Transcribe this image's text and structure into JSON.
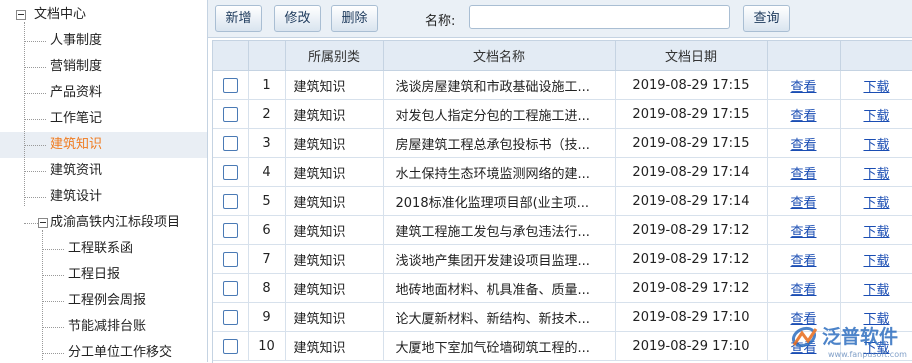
{
  "tree": {
    "items": [
      {
        "label": "文档中心",
        "level": 0,
        "expander": "−"
      },
      {
        "label": "人事制度",
        "level": 1
      },
      {
        "label": "营销制度",
        "level": 1
      },
      {
        "label": "产品资料",
        "level": 1
      },
      {
        "label": "工作笔记",
        "level": 1
      },
      {
        "label": "建筑知识",
        "level": 1,
        "selected": true
      },
      {
        "label": "建筑资讯",
        "level": 1
      },
      {
        "label": "建筑设计",
        "level": 1
      },
      {
        "label": "成渝高铁内江标段项目",
        "level": 1,
        "expander": "−"
      },
      {
        "label": "工程联系函",
        "level": 2
      },
      {
        "label": "工程日报",
        "level": 2
      },
      {
        "label": "工程例会周报",
        "level": 2
      },
      {
        "label": "节能减排台账",
        "level": 2
      },
      {
        "label": "分工单位工作移交",
        "level": 2
      }
    ]
  },
  "toolbar": {
    "add_label": "新增",
    "edit_label": "修改",
    "delete_label": "删除",
    "name_label": "名称:",
    "name_value": "",
    "query_label": "查询"
  },
  "grid": {
    "headers": [
      "",
      "",
      "所属别类",
      "文档名称",
      "文档日期",
      "",
      ""
    ],
    "rows": [
      {
        "index": "1",
        "category": "建筑知识",
        "name": "浅谈房屋建筑和市政基础设施工...",
        "date": "2019-08-29 17:15",
        "view": "查看",
        "download": "下载"
      },
      {
        "index": "2",
        "category": "建筑知识",
        "name": "对发包人指定分包的工程施工进...",
        "date": "2019-08-29 17:15",
        "view": "查看",
        "download": "下载"
      },
      {
        "index": "3",
        "category": "建筑知识",
        "name": "房屋建筑工程总承包投标书（技...",
        "date": "2019-08-29 17:15",
        "view": "查看",
        "download": "下载"
      },
      {
        "index": "4",
        "category": "建筑知识",
        "name": "水土保持生态环境监测网络的建...",
        "date": "2019-08-29 17:14",
        "view": "查看",
        "download": "下载"
      },
      {
        "index": "5",
        "category": "建筑知识",
        "name": "2018标准化监理项目部(业主项...",
        "date": "2019-08-29 17:14",
        "view": "查看",
        "download": "下载"
      },
      {
        "index": "6",
        "category": "建筑知识",
        "name": "建筑工程施工发包与承包违法行...",
        "date": "2019-08-29 17:12",
        "view": "查看",
        "download": "下载"
      },
      {
        "index": "7",
        "category": "建筑知识",
        "name": "浅谈地产集团开发建设项目监理...",
        "date": "2019-08-29 17:12",
        "view": "查看",
        "download": "下载"
      },
      {
        "index": "8",
        "category": "建筑知识",
        "name": "地砖地面材料、机具准备、质量...",
        "date": "2019-08-29 17:12",
        "view": "查看",
        "download": "下载"
      },
      {
        "index": "9",
        "category": "建筑知识",
        "name": "论大厦新材料、新结构、新技术...",
        "date": "2019-08-29 17:10",
        "view": "查看",
        "download": "下载"
      },
      {
        "index": "10",
        "category": "建筑知识",
        "name": "大厦地下室加气砼墙砌筑工程的...",
        "date": "2019-08-29 17:10",
        "view": "查看",
        "download": "下载"
      }
    ]
  },
  "watermark": {
    "brand": "泛普软件",
    "url": "www.fanpusoft.com"
  },
  "colors": {
    "selected_text": "#f07b1f",
    "link": "#1a4db3",
    "header_bg": "#e3ebf4",
    "toolbar_bg": "#eaf0f6",
    "brand": "#2f6fc0"
  }
}
